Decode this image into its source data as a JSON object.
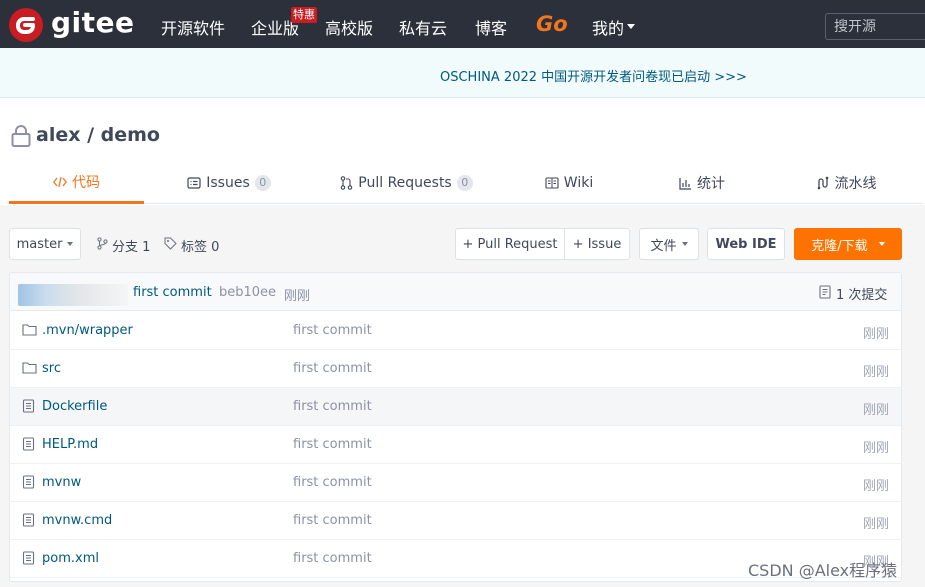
{
  "nav": {
    "logo_text": "gitee",
    "items": [
      "开源软件",
      "企业版",
      "高校版",
      "私有云",
      "博客"
    ],
    "badge": "特惠",
    "go": "Go",
    "mine": "我的",
    "search_placeholder": "搜开源"
  },
  "banner": {
    "text": "OSCHINA 2022 中国开源开发者问卷现已启动 >>>"
  },
  "project": {
    "owner": "alex",
    "separator": " / ",
    "name": "demo",
    "title": "alex / demo"
  },
  "tabs": [
    {
      "icon": "code-icon",
      "label": "代码",
      "count": ""
    },
    {
      "icon": "issues-icon",
      "label": "Issues",
      "count": "0"
    },
    {
      "icon": "pull-request-icon",
      "label": "Pull Requests",
      "count": "0"
    },
    {
      "icon": "wiki-icon",
      "label": "Wiki",
      "count": ""
    },
    {
      "icon": "stats-icon",
      "label": "统计",
      "count": ""
    },
    {
      "icon": "pipeline-icon",
      "label": "流水线",
      "count": ""
    }
  ],
  "toolbar": {
    "branch": "master",
    "branches": "分支 1",
    "tags": "标签 0",
    "new_pr": "+ Pull Request",
    "new_issue": "+ Issue",
    "file": "文件",
    "web_ide": "Web IDE",
    "clone": "克隆/下载"
  },
  "last_commit": {
    "message": "first commit",
    "hash": "beb10ee",
    "time": "刚刚",
    "count": "1 次提交"
  },
  "files": [
    {
      "type": "folder",
      "name": ".mvn/wrapper",
      "commit": "first commit",
      "time": "刚刚"
    },
    {
      "type": "folder",
      "name": "src",
      "commit": "first commit",
      "time": "刚刚"
    },
    {
      "type": "file",
      "name": "Dockerfile",
      "commit": "first commit",
      "time": "刚刚"
    },
    {
      "type": "file",
      "name": "HELP.md",
      "commit": "first commit",
      "time": "刚刚"
    },
    {
      "type": "file",
      "name": "mvnw",
      "commit": "first commit",
      "time": "刚刚"
    },
    {
      "type": "file",
      "name": "mvnw.cmd",
      "commit": "first commit",
      "time": "刚刚"
    },
    {
      "type": "file",
      "name": "pom.xml",
      "commit": "first commit",
      "time": "刚刚"
    }
  ],
  "watermark": "CSDN @Alex程序猿",
  "colors": {
    "nav_bg": "#2b303a",
    "accent": "#f3751c",
    "primary_button": "#fe7300",
    "brand_red": "#c71d23",
    "link": "#005980"
  }
}
